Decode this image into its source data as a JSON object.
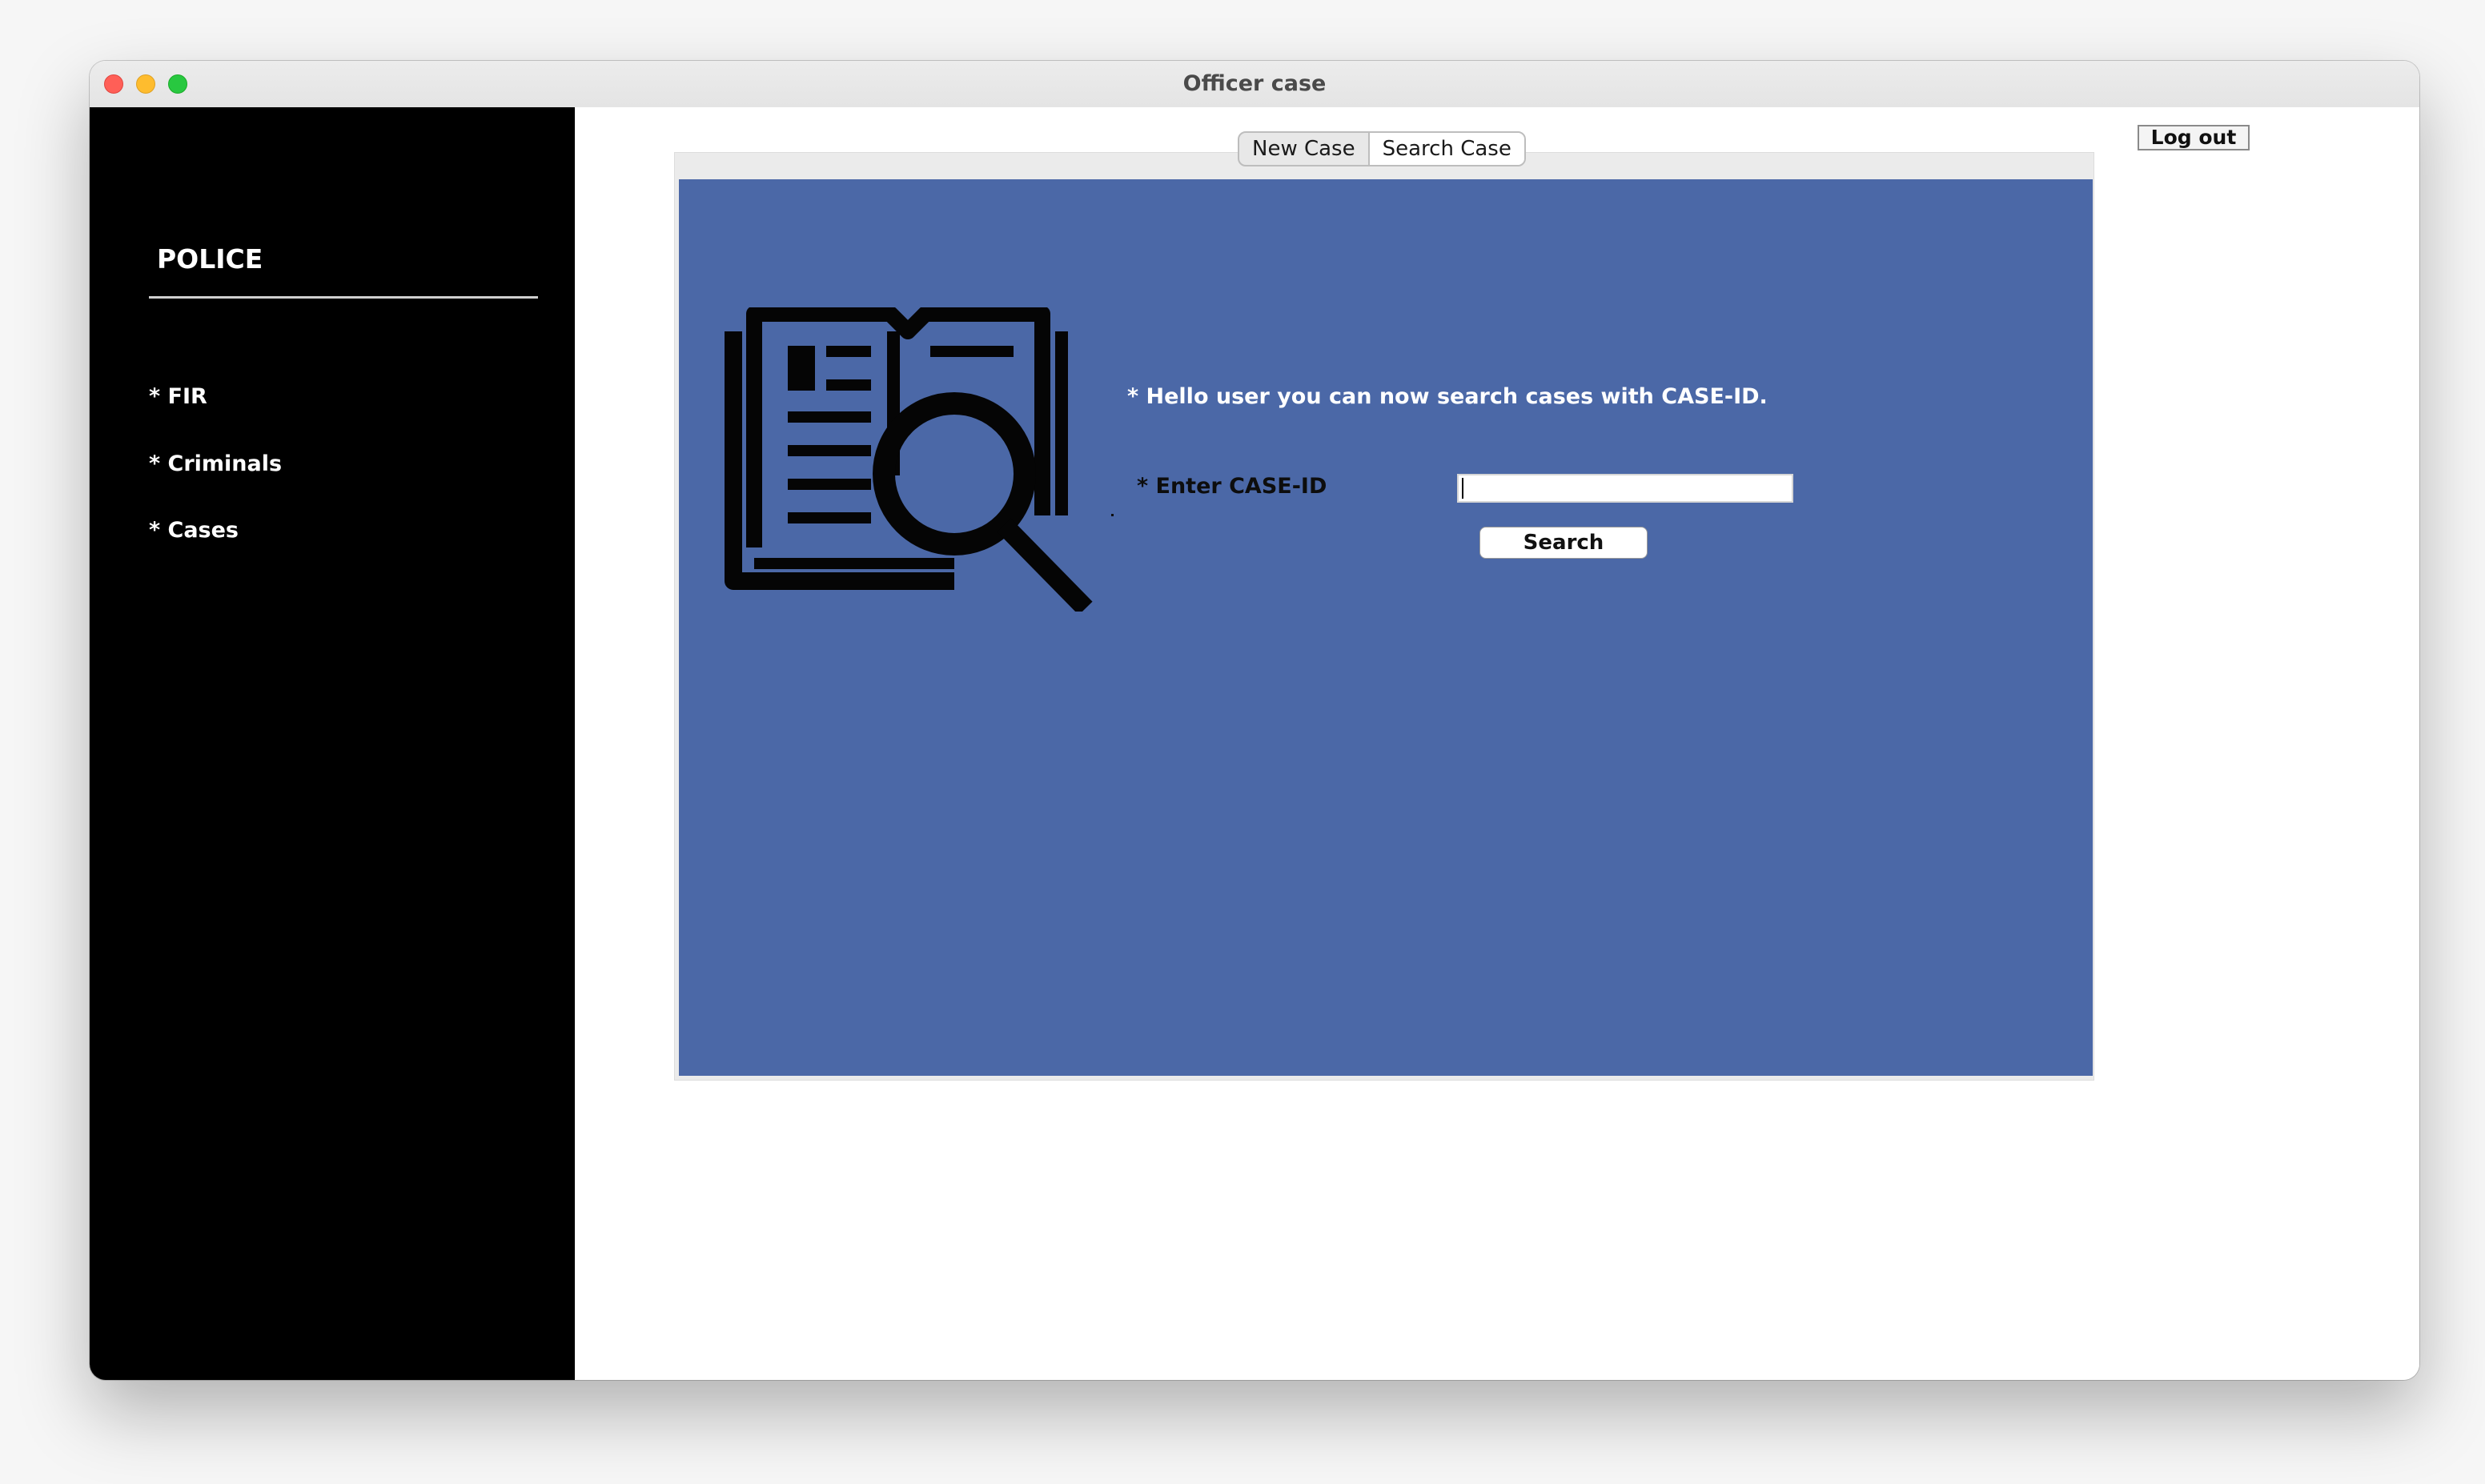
{
  "window": {
    "title": "Officer case"
  },
  "sidebar": {
    "brand": "POLICE",
    "items": [
      {
        "label": "* FIR"
      },
      {
        "label": "* Criminals"
      },
      {
        "label": "* Cases"
      }
    ]
  },
  "header": {
    "logout_label": "Log out"
  },
  "tabs": [
    {
      "label": "New Case",
      "active": false
    },
    {
      "label": "Search Case",
      "active": true
    }
  ],
  "search_panel": {
    "greeting": "* Hello user you can now search cases with CASE-ID.",
    "case_id_label": "* Enter CASE-ID",
    "case_id_value": "",
    "search_button_label": "Search",
    "icon": "book-magnifier-icon",
    "background_color": "#4b68a7"
  },
  "colors": {
    "sidebar_bg": "#000000",
    "panel_bg": "#4b68a7",
    "close": "#ff5f57",
    "minimize": "#febc2e",
    "maximize": "#28c840"
  }
}
